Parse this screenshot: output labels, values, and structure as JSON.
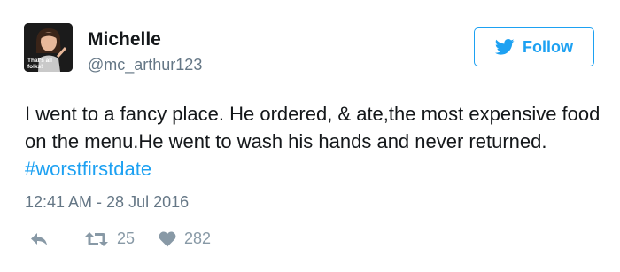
{
  "user": {
    "display_name": "Michelle",
    "handle": "@mc_arthur123",
    "avatar_caption": "That's all folks!"
  },
  "follow": {
    "label": "Follow",
    "icon": "twitter-bird-icon"
  },
  "tweet": {
    "text": "I went to a fancy place. He ordered, & ate,the most expensive food on the menu.He went to wash his hands and never returned. ",
    "hashtag": "#worstfirstdate",
    "timestamp": "12:41 AM - 28 Jul 2016"
  },
  "actions": {
    "reply_icon": "reply-icon",
    "retweet_icon": "retweet-icon",
    "retweet_count": "25",
    "like_icon": "heart-icon",
    "like_count": "282"
  },
  "colors": {
    "accent": "#1da1f2",
    "text": "#14171a",
    "muted": "#657786",
    "icon": "#8899a6"
  }
}
